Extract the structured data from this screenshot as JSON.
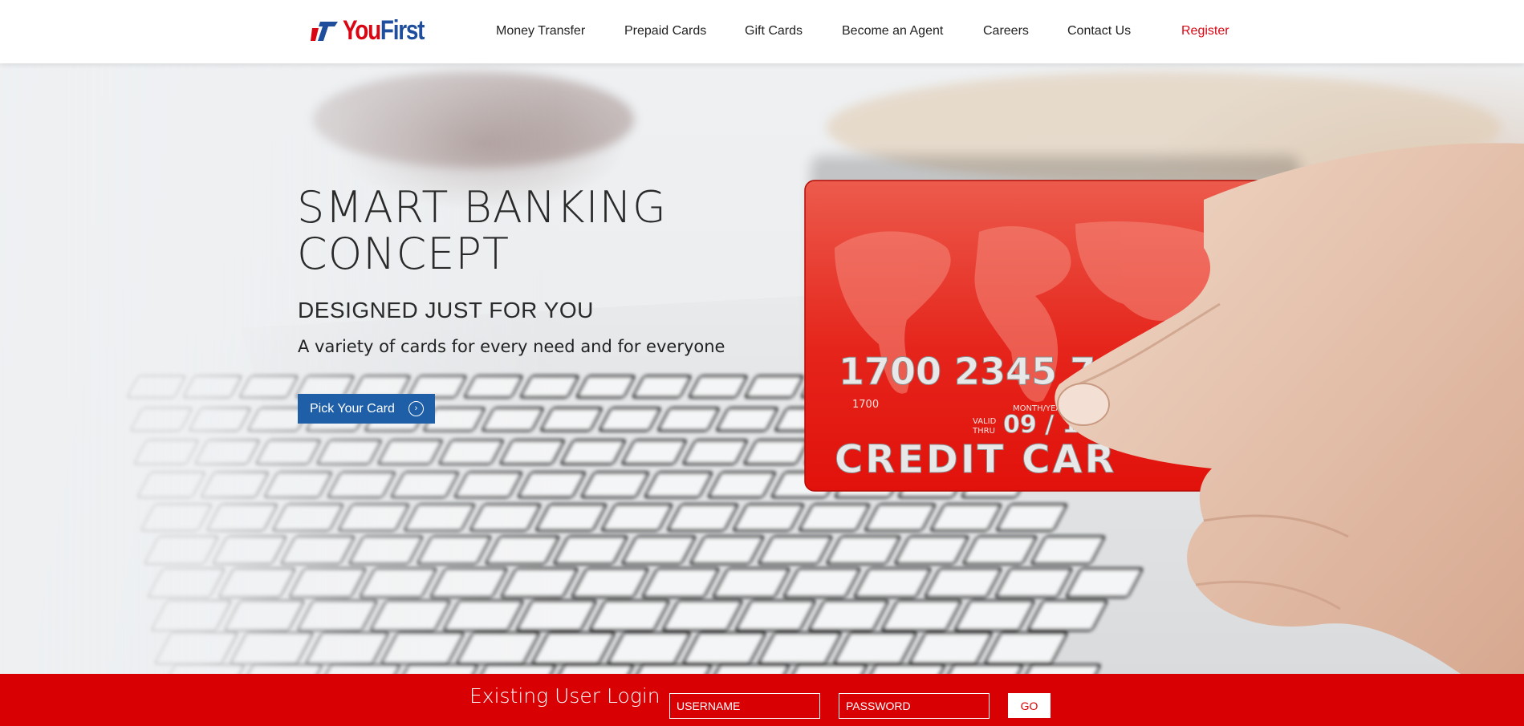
{
  "brand": {
    "name_part1": "You",
    "name_part2": "First",
    "colors": {
      "red": "#d90613",
      "blue": "#1f4e9c"
    }
  },
  "nav": {
    "items": [
      {
        "label": "Money Transfer"
      },
      {
        "label": "Prepaid Cards"
      },
      {
        "label": "Gift Cards"
      },
      {
        "label": "Become an Agent"
      },
      {
        "label": "Careers"
      },
      {
        "label": "Contact Us"
      }
    ],
    "register_label": "Register"
  },
  "hero": {
    "title_line1": "SMART BANKING",
    "title_line2": "CONCEPT",
    "subtitle": "DESIGNED JUST FOR YOU",
    "text": "A variety of cards for every need and for everyone",
    "cta_label": "Pick Your Card",
    "cta_icon": "chevron-right-circle-icon",
    "card": {
      "number_visible": "1700  2345  78",
      "small_number": "1700",
      "valid_label_1": "VALID",
      "valid_label_2": "THRU",
      "month_year_label": "MONTH/YEA",
      "expiry_visible": "09 / 1",
      "text_visible": "CREDIT CAR"
    }
  },
  "login": {
    "title": "Existing User Login",
    "username_placeholder": "USERNAME",
    "password_placeholder": "PASSWORD",
    "go_label": "GO",
    "bar_color": "#d90004"
  }
}
